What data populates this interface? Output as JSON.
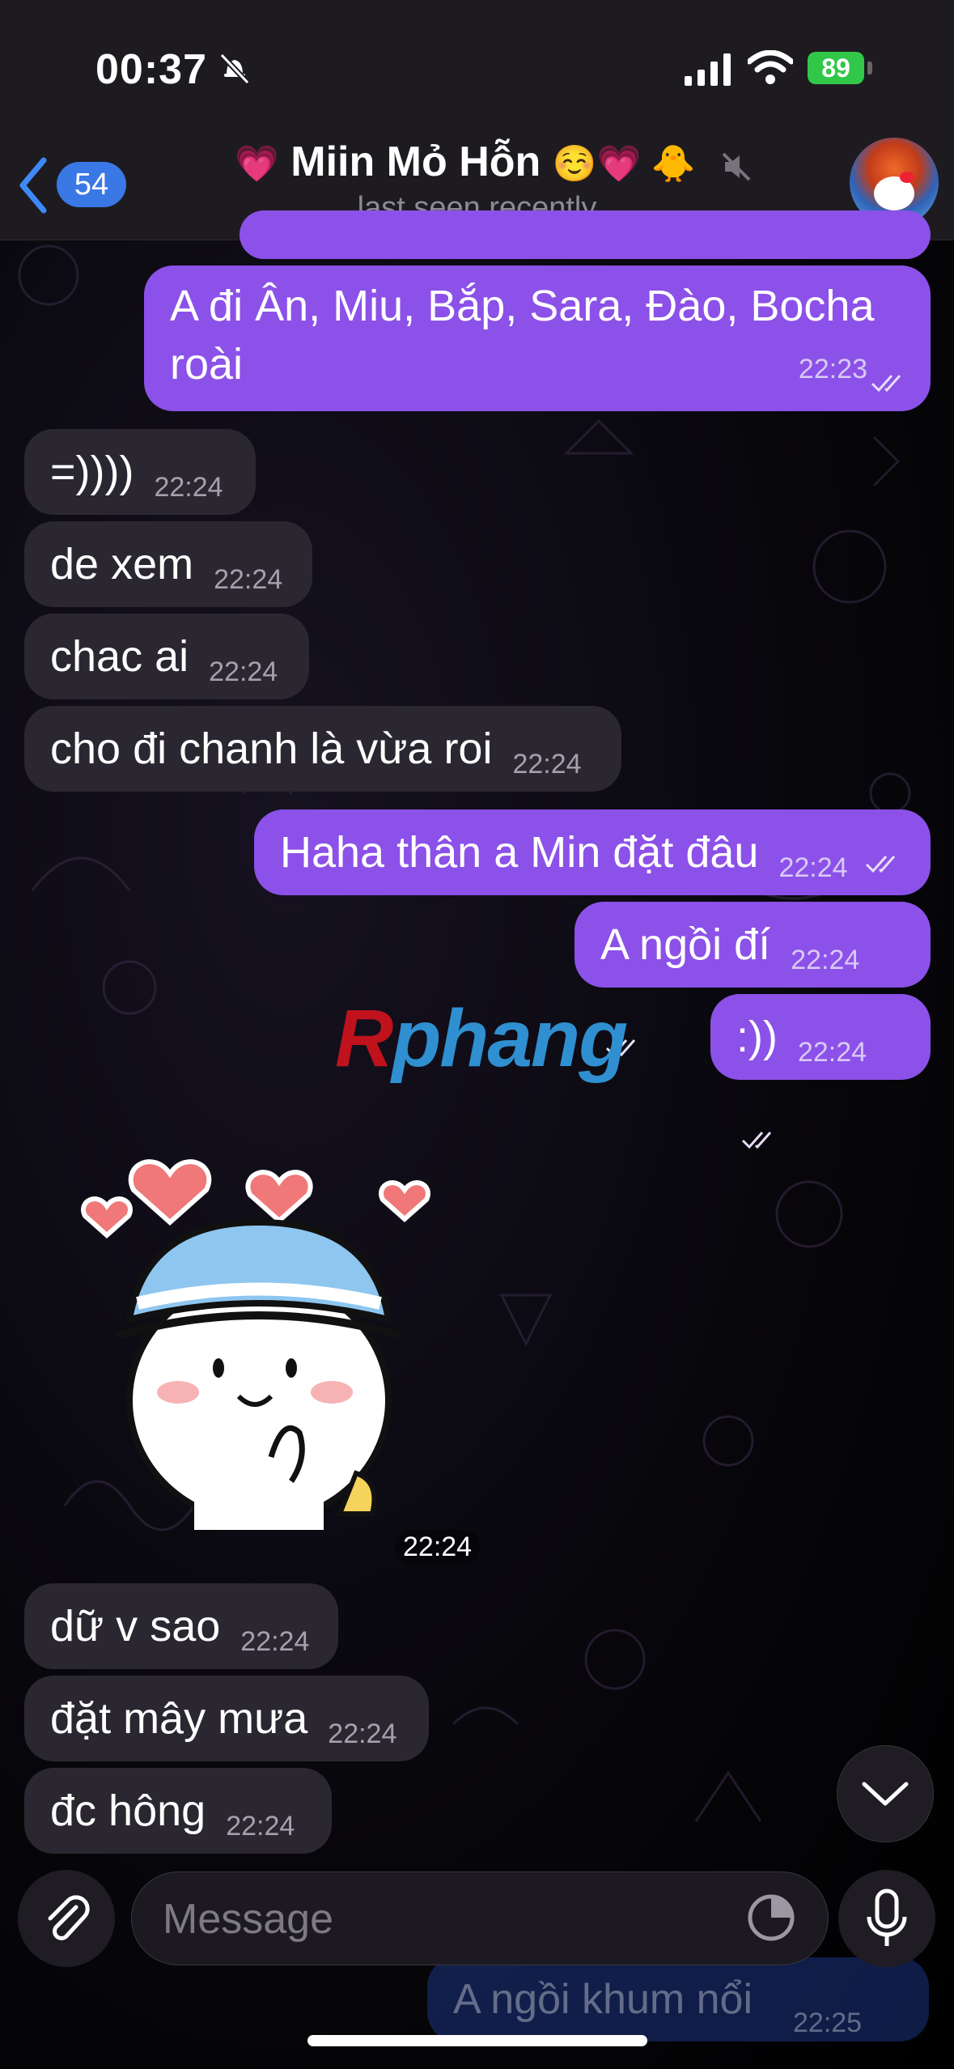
{
  "status_bar": {
    "time": "00:37",
    "battery": "89"
  },
  "header": {
    "back_count": "54",
    "title_prefix_emoji": "💗",
    "title": "Miin Mỏ Hỗn",
    "title_suffix_emojis": "☺️💗 🐥",
    "subtitle": "last seen recently"
  },
  "messages": [
    {
      "dir": "out",
      "text_line1": "A đi Ân, Miu, Bắp, Sara, Đào, Bocha",
      "text_line2": "roài",
      "time": "22:23"
    },
    {
      "dir": "in",
      "text": "=))))",
      "time": "22:24"
    },
    {
      "dir": "in",
      "text": "de xem",
      "time": "22:24"
    },
    {
      "dir": "in",
      "text": "chac ai",
      "time": "22:24"
    },
    {
      "dir": "in",
      "text": "cho đi chanh là vừa roi",
      "time": "22:24"
    },
    {
      "dir": "out",
      "text": "Haha thân a Min đặt đâu",
      "time": "22:24"
    },
    {
      "dir": "out",
      "text": "A ngồi đí",
      "time": "22:24"
    },
    {
      "dir": "out",
      "text": ":))",
      "time": "22:24"
    },
    {
      "dir": "in",
      "text": "dữ v sao",
      "time": "22:24"
    },
    {
      "dir": "in",
      "text": "đặt mây mưa",
      "time": "22:24"
    },
    {
      "dir": "in",
      "text": "đc hông",
      "time": "22:24"
    }
  ],
  "sticker": {
    "time": "22:24"
  },
  "watermark": {
    "first": "R",
    "rest": "phang"
  },
  "composer": {
    "placeholder": "Message"
  },
  "ghost_preview": {
    "text": "A ngồi khum nổi",
    "time": "22:25"
  }
}
